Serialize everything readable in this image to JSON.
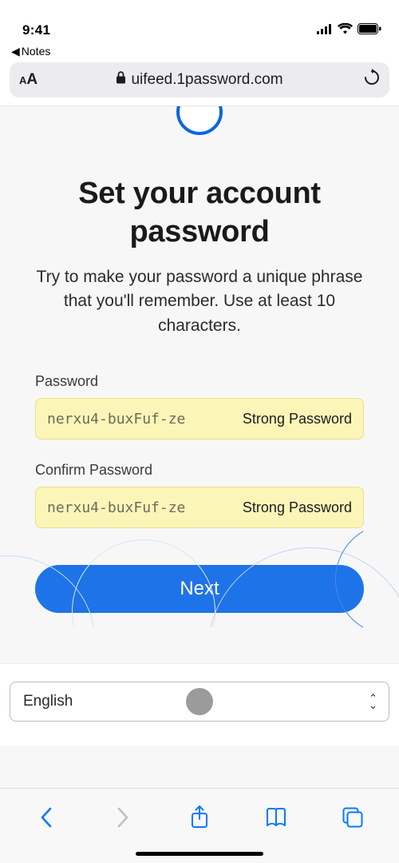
{
  "status": {
    "time": "9:41",
    "back_app_label": "Notes"
  },
  "browser": {
    "url_display": "uifeed.1password.com"
  },
  "page": {
    "title": "Set your account password",
    "subtitle": "Try to make your password a unique phrase that you'll remember. Use at least 10 characters.",
    "password_label": "Password",
    "confirm_label": "Confirm Password",
    "password_value": "nerxu4-buxFuf-ze",
    "confirm_value": "nerxu4-buxFuf-ze",
    "strength_label": "Strong Password",
    "next_label": "Next"
  },
  "footer": {
    "language": "English"
  }
}
